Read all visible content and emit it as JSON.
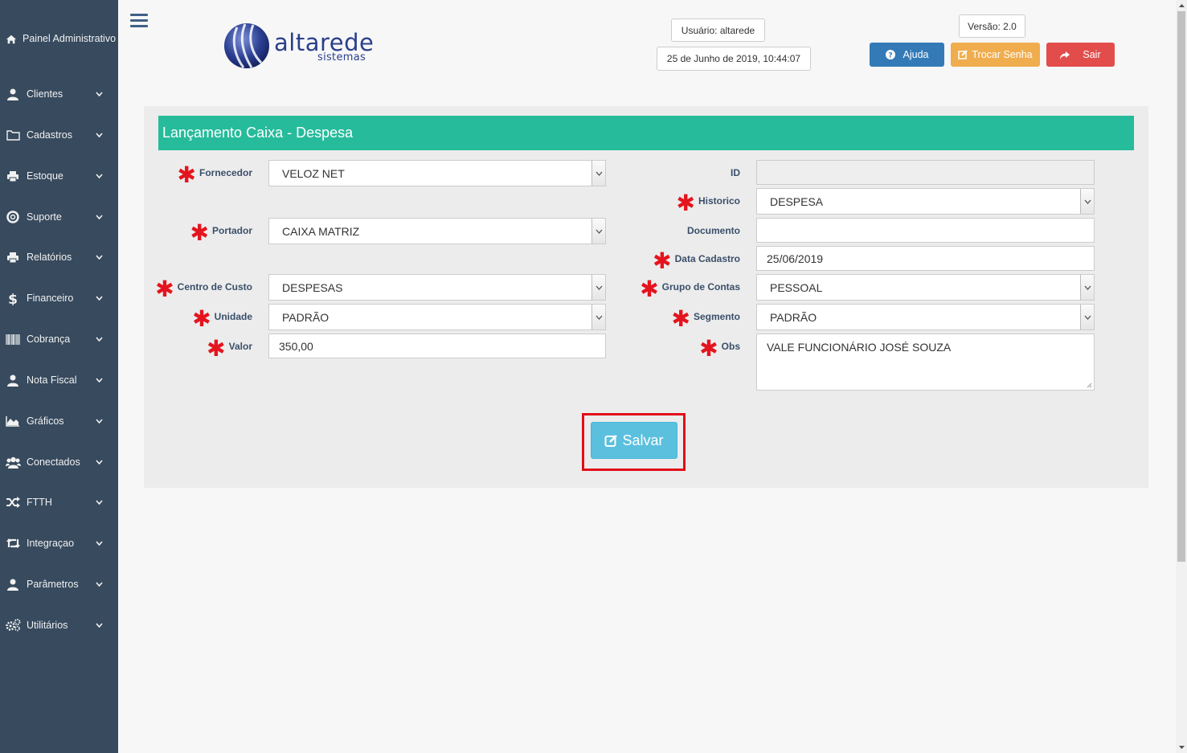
{
  "sidebar": {
    "painel": "Painel Administrativo",
    "items": [
      {
        "label": "Clientes",
        "icon": "user-icon"
      },
      {
        "label": "Cadastros",
        "icon": "folder-icon"
      },
      {
        "label": "Estoque",
        "icon": "printer-icon"
      },
      {
        "label": "Suporte",
        "icon": "lifebuoy-icon"
      },
      {
        "label": "Relatórios",
        "icon": "printer-icon"
      },
      {
        "label": "Financeiro",
        "icon": "dollar-icon"
      },
      {
        "label": "Cobrança",
        "icon": "barcode-icon"
      },
      {
        "label": "Nota Fiscal",
        "icon": "user-icon"
      },
      {
        "label": "Gráficos",
        "icon": "area-chart-icon"
      },
      {
        "label": "Conectados",
        "icon": "users-icon"
      },
      {
        "label": "FTTH",
        "icon": "random-icon"
      },
      {
        "label": "Integraçao",
        "icon": "retweet-icon"
      },
      {
        "label": "Parâmetros",
        "icon": "user-icon"
      },
      {
        "label": "Utilitários",
        "icon": "cogs-icon"
      }
    ]
  },
  "header": {
    "logo_text": "altarede",
    "logo_sub": "sistemas",
    "usuario": "Usuário: altarede",
    "datetime": "25 de Junho de 2019, 10:44:07",
    "versao": "Versão: 2.0",
    "ajuda": "Ajuda",
    "trocar_senha": "Trocar Senha",
    "sair": "Sair",
    "colors": {
      "ajuda": "#337ab7",
      "trocar": "#f0ad4e",
      "sair": "#e24d4b"
    }
  },
  "form": {
    "title": "Lançamento Caixa - Despesa",
    "left": {
      "fornecedor": {
        "label": "Fornecedor",
        "value": "VELOZ NET"
      },
      "portador": {
        "label": "Portador",
        "value": "CAIXA MATRIZ"
      },
      "centro_custo": {
        "label": "Centro de Custo",
        "value": "DESPESAS"
      },
      "unidade": {
        "label": "Unidade",
        "value": "PADRÃO"
      },
      "valor": {
        "label": "Valor",
        "value": "350,00"
      }
    },
    "right": {
      "id": {
        "label": "ID",
        "value": ""
      },
      "historico": {
        "label": "Historico",
        "value": "DESPESA"
      },
      "documento": {
        "label": "Documento",
        "value": ""
      },
      "data_cadastro": {
        "label": "Data Cadastro",
        "value": "25/06/2019"
      },
      "grupo_contas": {
        "label": "Grupo de Contas",
        "value": "PESSOAL"
      },
      "segmento": {
        "label": "Segmento",
        "value": "PADRÃO"
      },
      "obs": {
        "label": "Obs",
        "value": "VALE FUNCIONÁRIO JOSÉ SOUZA"
      }
    },
    "salvar": "Salvar",
    "header_color": "#26bb9b",
    "required_mark": "✱"
  }
}
